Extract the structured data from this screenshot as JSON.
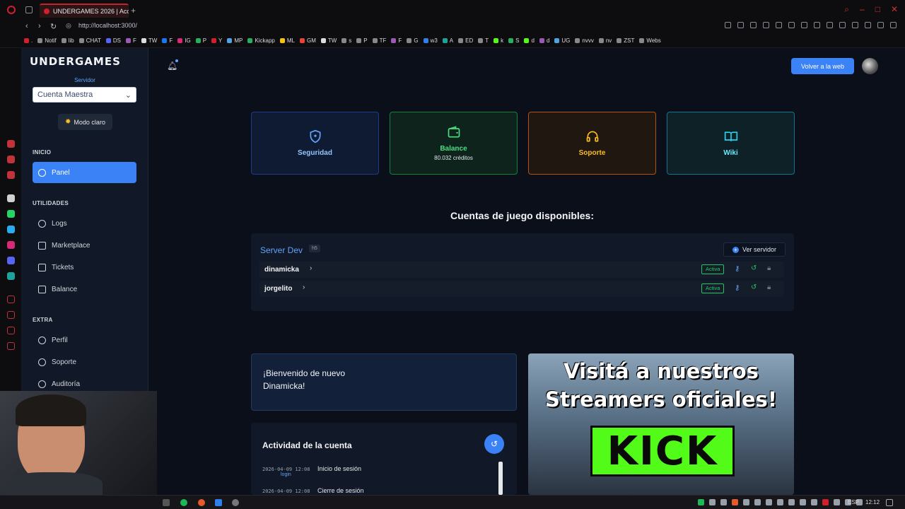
{
  "browser": {
    "tab_title": "UNDERGAMES 2026 | Acc",
    "url": "http://localhost:3000/",
    "bookmarks": [
      ".",
      "Notif",
      "lib",
      "CHAT",
      "DS",
      "F",
      "TW",
      "F",
      "IG",
      "P",
      "Y",
      "MP",
      "Kickapp",
      "ML",
      "GM",
      "TW",
      "s",
      "P",
      "TF",
      "F",
      "G",
      "w3",
      "A",
      "ED",
      "T",
      "k",
      "S",
      "d",
      "d",
      "UG",
      "nvvv",
      "nv",
      "ZST",
      "Webs"
    ]
  },
  "sidebar": {
    "logo": "UNDERGAMES",
    "server_label": "Servidor",
    "server_value": "Cuenta Maestra",
    "mode_button": "Modo claro",
    "sections": {
      "inicio": "INICIO",
      "utilidades": "UTILIDADES",
      "extra": "EXTRA"
    },
    "items": {
      "panel": "Panel",
      "logs": "Logs",
      "marketplace": "Marketplace",
      "tickets": "Tickets",
      "balance": "Balance",
      "perfil": "Perfil",
      "soporte": "Soporte",
      "auditoria": "Auditoría"
    }
  },
  "header": {
    "back_button": "Volver a la web"
  },
  "cards": {
    "seguridad": "Seguridad",
    "balance": "Balance",
    "balance_value": "80.032 créditos",
    "soporte": "Soporte",
    "wiki": "Wiki"
  },
  "accounts": {
    "title": "Cuentas de juego disponibles:",
    "server_name": "Server Dev",
    "server_tag": "h5",
    "view_server": "Ver servidor",
    "rows": [
      {
        "name": "dinamicka",
        "status": "Activa"
      },
      {
        "name": "jorgelito",
        "status": "Activa"
      }
    ]
  },
  "welcome": {
    "line1": "¡Bienvenido de nuevo",
    "line2": "Dinamicka!"
  },
  "activity": {
    "title": "Actividad de la cuenta",
    "entries": [
      {
        "time": "2026-04-09 12:08",
        "tag": "login",
        "text": "Inicio de sesión"
      },
      {
        "time": "2026-04-09 12:08",
        "tag": "",
        "text": "Cierre de sesión"
      }
    ]
  },
  "promo": {
    "line1": "Visitá a nuestros",
    "line2": "Streamers oficiales!",
    "brand": "KICK"
  },
  "taskbar": {
    "lang": "ESP",
    "time": "12:12"
  },
  "colors": {
    "accent": "#3b82f6",
    "success": "#22c55e",
    "kick": "#53fc18"
  }
}
